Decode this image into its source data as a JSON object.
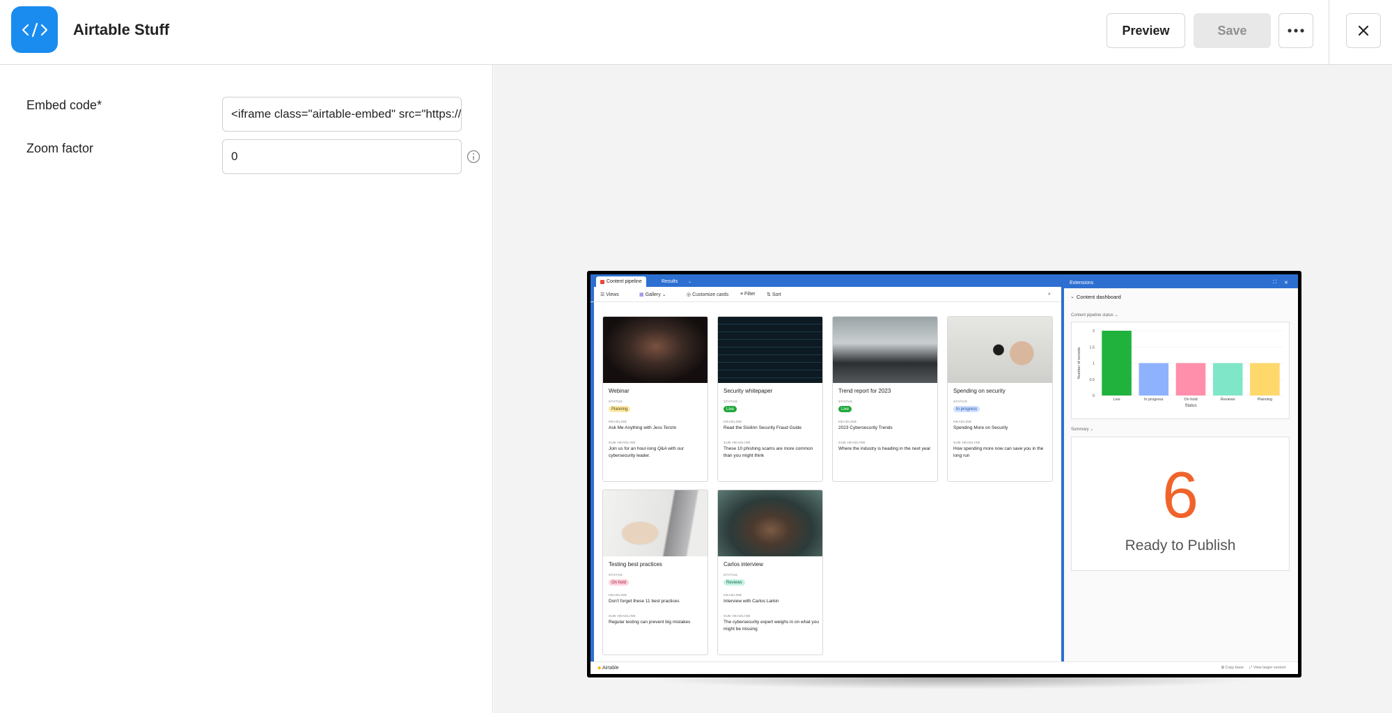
{
  "header": {
    "app_title": "Airtable Stuff",
    "preview_label": "Preview",
    "save_label": "Save"
  },
  "form": {
    "embed_code_label": "Embed code*",
    "embed_code_value": "<iframe class=\"airtable-embed\" src=\"https://airtable.com/embed/",
    "zoom_label": "Zoom factor",
    "zoom_value": "0"
  },
  "embed": {
    "tabs": [
      "Content pipeline",
      "Results"
    ],
    "toolbar": [
      "Views",
      "Gallery",
      "Customize cards",
      "Filter",
      "Sort"
    ],
    "field_labels": {
      "status": "STATUS",
      "headline": "HEADLINE",
      "subheadline": "SUB HEADLINE"
    },
    "cards": [
      {
        "title": "Webinar",
        "status": "Planning",
        "headline": "Ask Me Anything with Jess Tenzin",
        "subheadline": "Join us for an hour-long Q&A with our cybersecurity leader."
      },
      {
        "title": "Security whitepaper",
        "status": "Live",
        "headline": "Read the Sisilinn Security Fraud Guide",
        "subheadline": "These 10 phishing scams are more common than you might think"
      },
      {
        "title": "Trend report for 2023",
        "status": "Live",
        "headline": "2023 Cybersecurity Trends",
        "subheadline": "Where the industry is heading in the next year"
      },
      {
        "title": "Spending on security",
        "status": "In progress",
        "headline": "Spending More on Security",
        "subheadline": "How spending more now can save you in the long run"
      },
      {
        "title": "Testing best practices",
        "status": "On hold",
        "headline": "Don't forget these 11 best practices",
        "subheadline": "Regular testing can prevent big mistakes"
      },
      {
        "title": "Carlos interview",
        "status": "Reviews",
        "headline": "Interview with Carlos Larkin",
        "subheadline": "The cybersecurity expert weighs in on what you might be missing"
      }
    ],
    "status_colors": {
      "Planning": {
        "bg": "#fde9a8",
        "fg": "#5a4500"
      },
      "Live": {
        "bg": "#20a83a",
        "fg": "#ffffff"
      },
      "In progress": {
        "bg": "#cfe0ff",
        "fg": "#1e4fa8"
      },
      "On hold": {
        "bg": "#fcd3dc",
        "fg": "#a3213e"
      },
      "Reviews": {
        "bg": "#c7f2e3",
        "fg": "#136b4f"
      }
    },
    "extensions_title": "Extensions",
    "dashboard_title": "Content dashboard",
    "chart_section_label": "Content pipeline status",
    "summary_section_label": "Summary",
    "summary_number": "6",
    "summary_caption": "Ready to Publish",
    "footer_brand": "Airtable",
    "footer_links": [
      "Copy base",
      "View larger version"
    ]
  },
  "chart_data": {
    "type": "bar",
    "categories": [
      "Live",
      "In progress",
      "On hold",
      "Reviews",
      "Planning"
    ],
    "values": [
      2,
      1,
      1,
      1,
      1
    ],
    "colors": [
      "#20b23c",
      "#8fb2ff",
      "#ff8fab",
      "#80e6c8",
      "#ffd86b"
    ],
    "xlabel": "Status",
    "ylabel": "Number of records",
    "yticks": [
      "0",
      "0.5",
      "1",
      "1.5",
      "2"
    ],
    "ylim": [
      0,
      2
    ]
  }
}
